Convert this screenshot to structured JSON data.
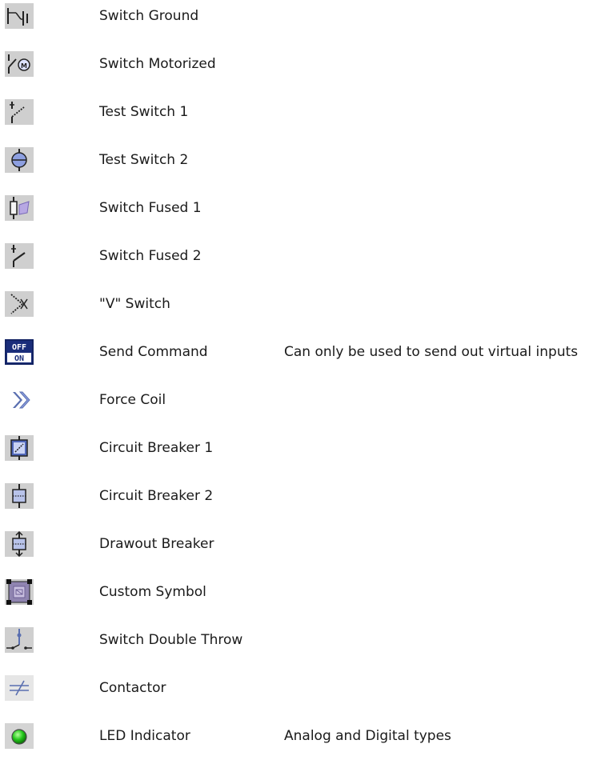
{
  "items": [
    {
      "icon": "switch-ground-icon",
      "label": "Switch Ground",
      "note": ""
    },
    {
      "icon": "switch-motorized-icon",
      "label": "Switch Motorized",
      "note": ""
    },
    {
      "icon": "test-switch-1-icon",
      "label": "Test Switch 1",
      "note": ""
    },
    {
      "icon": "test-switch-2-icon",
      "label": "Test Switch 2",
      "note": ""
    },
    {
      "icon": "switch-fused-1-icon",
      "label": "Switch Fused 1",
      "note": ""
    },
    {
      "icon": "switch-fused-2-icon",
      "label": "Switch Fused 2",
      "note": ""
    },
    {
      "icon": "v-switch-icon",
      "label": "\"V\" Switch",
      "note": ""
    },
    {
      "icon": "send-command-icon",
      "label": "Send Command",
      "note": "Can only be used to send out virtual inputs"
    },
    {
      "icon": "force-coil-icon",
      "label": "Force Coil",
      "note": ""
    },
    {
      "icon": "circuit-breaker-1-icon",
      "label": "Circuit Breaker 1",
      "note": ""
    },
    {
      "icon": "circuit-breaker-2-icon",
      "label": "Circuit Breaker 2",
      "note": ""
    },
    {
      "icon": "drawout-breaker-icon",
      "label": "Drawout Breaker",
      "note": ""
    },
    {
      "icon": "custom-symbol-icon",
      "label": "Custom Symbol",
      "note": ""
    },
    {
      "icon": "switch-double-throw-icon",
      "label": "Switch Double Throw",
      "note": ""
    },
    {
      "icon": "contactor-icon",
      "label": "Contactor",
      "note": ""
    },
    {
      "icon": "led-indicator-icon",
      "label": "LED Indicator",
      "note": "Analog and Digital types"
    }
  ],
  "send_command_icon_text": {
    "top": "OFF",
    "bottom": "ON"
  },
  "colors": {
    "icon_bg": "#cfcfcf",
    "symbol_blue": "#5a6fb0",
    "symbol_fill": "#b8c3ea",
    "custom_fill": "#8f84b0",
    "led_green": "#22c71a",
    "send_cmd_bg": "#1a2d7a"
  }
}
